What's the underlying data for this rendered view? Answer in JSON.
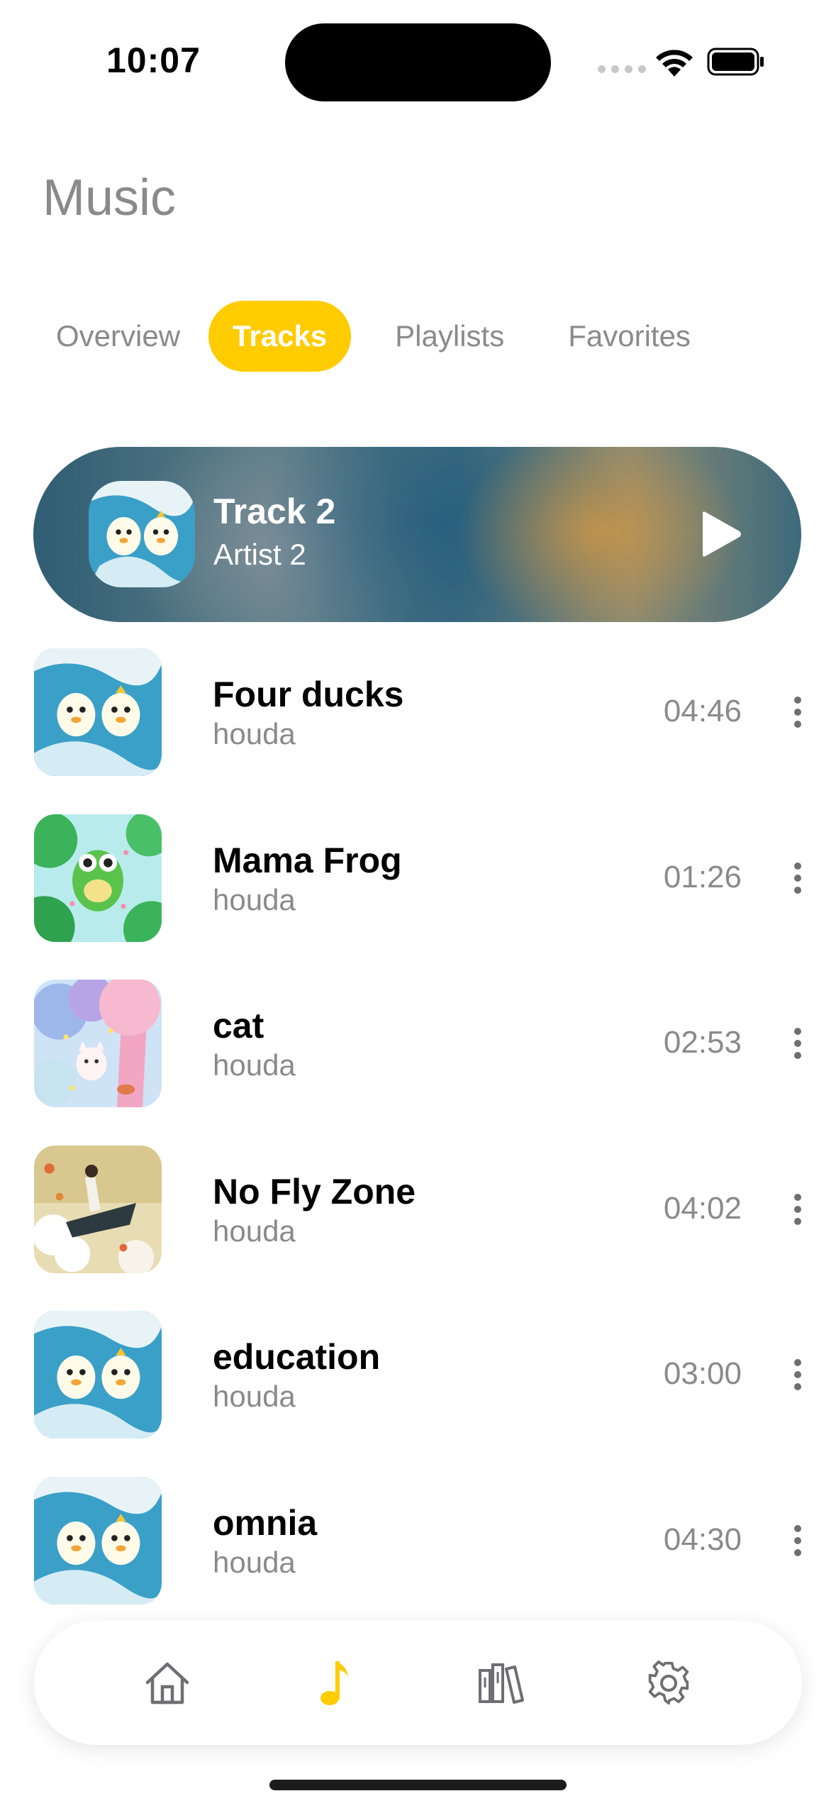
{
  "status_bar": {
    "time": "10:07"
  },
  "header": {
    "title": "Music"
  },
  "tabs": [
    {
      "label": "Overview",
      "active": false
    },
    {
      "label": "Tracks",
      "active": true
    },
    {
      "label": "Playlists",
      "active": false
    },
    {
      "label": "Favorites",
      "active": false
    }
  ],
  "now_playing": {
    "title": "Track 2",
    "artist": "Artist 2",
    "art": "ducks-artwork",
    "action_icon": "play-icon"
  },
  "tracks": [
    {
      "title": "Four ducks",
      "artist": "houda",
      "duration": "04:46",
      "art": "ducks-artwork"
    },
    {
      "title": "Mama Frog",
      "artist": "houda",
      "duration": "01:26",
      "art": "frog-artwork"
    },
    {
      "title": "cat",
      "artist": "houda",
      "duration": "02:53",
      "art": "cat-artwork"
    },
    {
      "title": "No Fly Zone",
      "artist": "houda",
      "duration": "04:02",
      "art": "flight-artwork"
    },
    {
      "title": "education",
      "artist": "houda",
      "duration": "03:00",
      "art": "ducks-artwork"
    },
    {
      "title": "omnia",
      "artist": "houda",
      "duration": "04:30",
      "art": "ducks-artwork"
    }
  ],
  "bottom_nav": [
    {
      "icon": "home-icon",
      "active": false
    },
    {
      "icon": "music-note-icon",
      "active": true
    },
    {
      "icon": "library-icon",
      "active": false
    },
    {
      "icon": "settings-gear-icon",
      "active": false
    }
  ],
  "colors": {
    "accent": "#ffcc00",
    "secondary_text": "#8a8a8e"
  }
}
